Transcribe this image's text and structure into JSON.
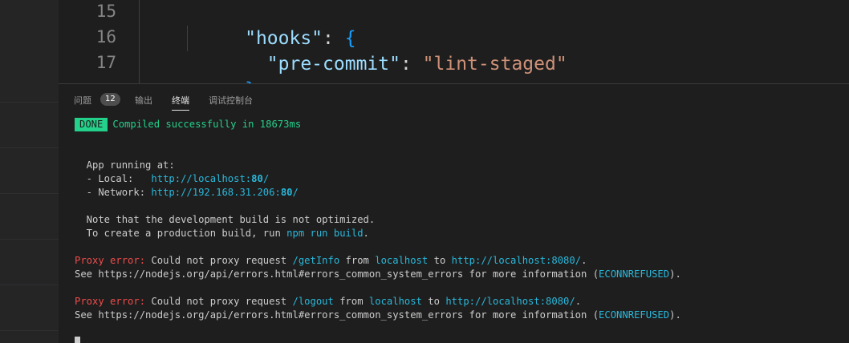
{
  "editor": {
    "lines": [
      {
        "number": "15",
        "parts": [
          {
            "text": "\"hooks\"",
            "cls": "tk-keyname"
          },
          {
            "text": ": ",
            "cls": "tk-punc"
          },
          {
            "text": "{",
            "cls": "tk-brace"
          }
        ]
      },
      {
        "number": "16",
        "parts": [
          {
            "text": "  ",
            "cls": "tk-punc"
          },
          {
            "text": "\"pre-commit\"",
            "cls": "tk-keyname"
          },
          {
            "text": ": ",
            "cls": "tk-punc"
          },
          {
            "text": "\"lint-staged\"",
            "cls": "tk-str"
          }
        ]
      },
      {
        "number": "17",
        "parts": [
          {
            "text": "}",
            "cls": "tk-brace"
          }
        ]
      }
    ]
  },
  "panel": {
    "tabs": [
      {
        "label": "问题",
        "active": false
      },
      {
        "label": "输出",
        "active": false
      },
      {
        "label": "终端",
        "active": true
      },
      {
        "label": "调试控制台",
        "active": false
      }
    ],
    "problems_count": "12"
  },
  "terminal": {
    "done_badge": "DONE",
    "compiled": "Compiled successfully in 18673ms",
    "app_running": "  App running at:",
    "local_label": "  - Local:   ",
    "local_url_prefix": "http://localhost:",
    "local_port": "80",
    "local_suffix": "/",
    "network_label": "  - Network: ",
    "network_url_prefix": "http://192.168.31.206:",
    "network_port": "80",
    "network_suffix": "/",
    "note1": "  Note that the development build is not optimized.",
    "note2_prefix": "  To create a production build, run ",
    "note2_cmd": "npm run build",
    "note2_suffix": ".",
    "errors": [
      {
        "label": "Proxy error:",
        "text1": " Could not proxy request ",
        "path": "/getInfo",
        "text2": " from ",
        "host": "localhost",
        "text3": " to ",
        "target": "http://localhost:8080/",
        "text4": ".",
        "see_prefix": "See https://nodejs.org/api/errors.html#errors_common_system_errors for more information (",
        "code": "ECONNREFUSED",
        "see_suffix": ")."
      },
      {
        "label": "Proxy error:",
        "text1": " Could not proxy request ",
        "path": "/logout",
        "text2": " from ",
        "host": "localhost",
        "text3": " to ",
        "target": "http://localhost:8080/",
        "text4": ".",
        "see_prefix": "See https://nodejs.org/api/errors.html#errors_common_system_errors for more information (",
        "code": "ECONNREFUSED",
        "see_suffix": ")."
      }
    ]
  },
  "colors": {
    "background": "#1e1e1e",
    "done_badge": "#23d18b",
    "link": "#29b8db",
    "error": "#f14c4c"
  }
}
